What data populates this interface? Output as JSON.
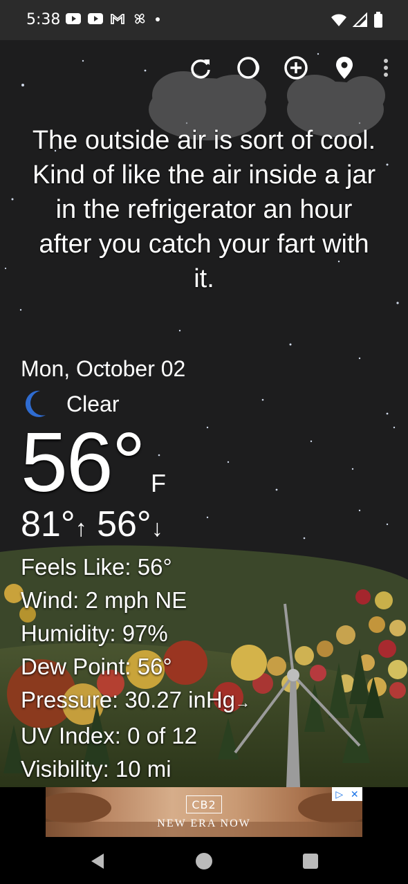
{
  "status": {
    "time": "5:38",
    "left_icons": [
      "youtube-icon",
      "youtube-icon",
      "gmail-icon",
      "pinwheel-icon",
      "dot-icon"
    ],
    "right_icons": [
      "wifi-icon",
      "cell-signal-icon",
      "battery-icon"
    ]
  },
  "toolbar": {
    "buttons": [
      "refresh-icon",
      "theme-icon",
      "add-location-icon",
      "location-pin-icon",
      "overflow-menu-icon"
    ]
  },
  "quote": "The outside air is sort of cool. Kind of like the air inside a jar in the refrigerator an hour after you catch your fart with it.",
  "weather": {
    "date": "Mon, October 02",
    "condition": "Clear",
    "condition_icon": "moon-icon",
    "temperature": "56°",
    "unit": "F",
    "high": "81°",
    "low": "56°",
    "high_arrow": "↑",
    "low_arrow": "↓"
  },
  "details": {
    "feels_like": "Feels Like:  56°",
    "wind": "Wind:  2 mph NE",
    "humidity": "Humidity:  97%",
    "dew_point": "Dew Point:  56°",
    "pressure": "Pressure:  30.27 inHg",
    "pressure_arrow": "→",
    "uv_index": "UV Index:  0 of 12",
    "visibility": "Visibility:  10 mi"
  },
  "ad": {
    "logo": "CB2",
    "tagline": "NEW ERA NOW",
    "choices_icon": "ad-choices-icon",
    "close": "✕"
  },
  "nav": [
    "back-icon",
    "home-icon",
    "recents-icon"
  ],
  "colors": {
    "sky": "#1d1d1e",
    "grass": "#3d4a2a",
    "moon": "#2f6cd1"
  }
}
